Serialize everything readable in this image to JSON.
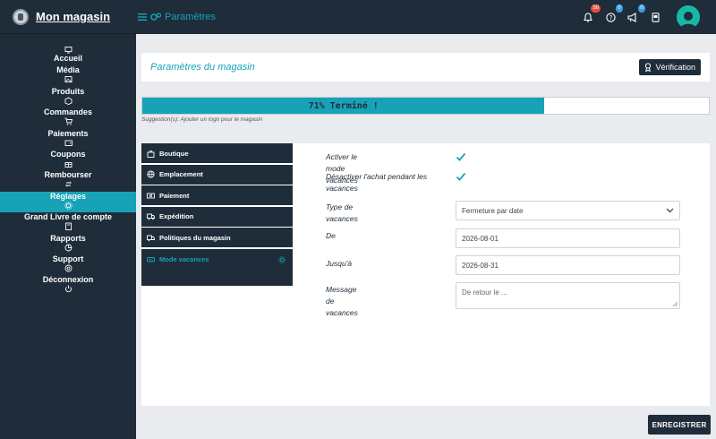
{
  "app": {
    "brand": "Mon magasin"
  },
  "topbar": {
    "title": "Paramètres",
    "notifications_count": "58",
    "help_count": "0",
    "announce_count": "0"
  },
  "sidebar": {
    "items": [
      {
        "label": "Accueil",
        "icon": "monitor-icon"
      },
      {
        "label": "Média",
        "icon": "image-icon"
      },
      {
        "label": "Produits",
        "icon": "box-icon"
      },
      {
        "label": "Commandes",
        "icon": "cart-icon"
      },
      {
        "label": "Paiements",
        "icon": "wallet-icon"
      },
      {
        "label": "Coupons",
        "icon": "gift-icon"
      },
      {
        "label": "Rembourser",
        "icon": "refund-icon"
      },
      {
        "label": "Réglages",
        "icon": "gear-icon",
        "active": true
      },
      {
        "label": "Grand Livre de compte",
        "icon": "book-icon"
      },
      {
        "label": "Rapports",
        "icon": "chart-icon"
      },
      {
        "label": "Support",
        "icon": "lifebuoy-icon"
      },
      {
        "label": "Déconnexion",
        "icon": "power-icon"
      }
    ]
  },
  "header_card": {
    "title": "Paramètres du magasin",
    "verify_label": "Vérification"
  },
  "progress": {
    "percent": 71,
    "label": "71% Terminé !",
    "suggestion": "Suggestion(s): Ajouter un logo pour le magasin"
  },
  "settings_menu": [
    {
      "label": "Boutique",
      "icon": "store-icon"
    },
    {
      "label": "Emplacement",
      "icon": "globe-icon"
    },
    {
      "label": "Paiement",
      "icon": "money-icon"
    },
    {
      "label": "Expédition",
      "icon": "truck-icon"
    },
    {
      "label": "Politiques du magasin",
      "icon": "policy-icon"
    },
    {
      "label": "Mode vacances",
      "icon": "vacation-icon",
      "active": true
    }
  ],
  "form": {
    "vacation_mode_label": "Activer le mode vacances",
    "vacation_mode_checked": true,
    "disable_purchase_label": "Désactiver l'achat pendant les vacances",
    "disable_purchase_checked": true,
    "type_label": "Type de vacances",
    "type_value": "Fermeture par date",
    "from_label": "De",
    "from_value": "2026-08-01",
    "to_label": "Jusqu'à",
    "to_value": "2026-08-31",
    "message_label": "Message de vacances",
    "message_placeholder": "De retour le ..."
  },
  "save_label": "ENREGISTRER",
  "colors": {
    "dark": "#1f2d3a",
    "accent": "#17a2b8"
  }
}
